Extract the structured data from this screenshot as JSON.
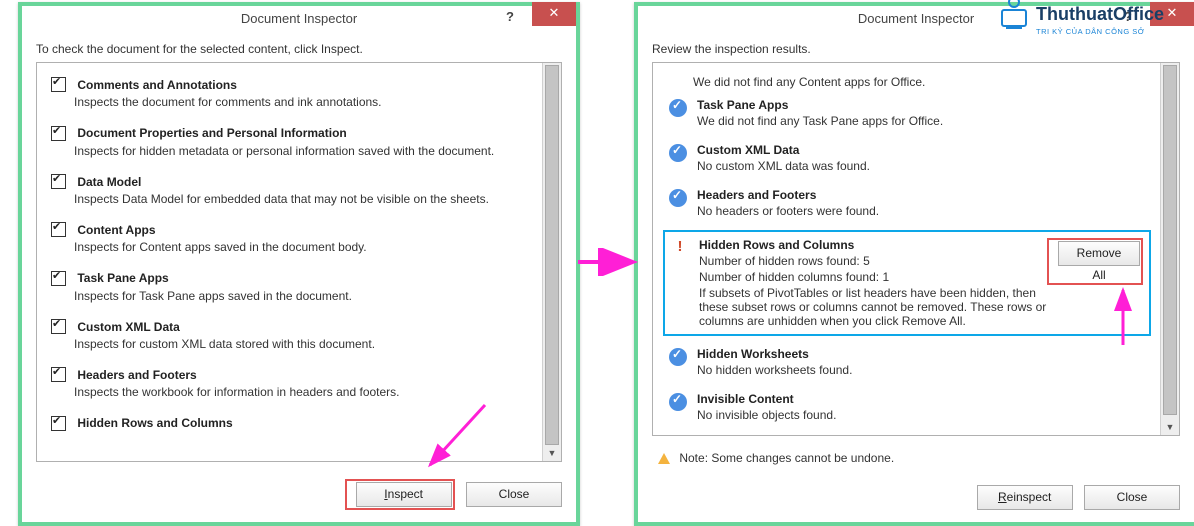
{
  "dialog1": {
    "title": "Document Inspector",
    "intro": "To check the document for the selected content, click Inspect.",
    "items": [
      {
        "label": "Comments and Annotations",
        "desc": "Inspects the document for comments and ink annotations."
      },
      {
        "label": "Document Properties and Personal Information",
        "desc": "Inspects for hidden metadata or personal information saved with the document."
      },
      {
        "label": "Data Model",
        "desc": "Inspects Data Model for embedded data that may not be visible on the sheets."
      },
      {
        "label": "Content Apps",
        "desc": "Inspects for Content apps saved in the document body."
      },
      {
        "label": "Task Pane Apps",
        "desc": "Inspects for Task Pane apps saved in the document."
      },
      {
        "label": "Custom XML Data",
        "desc": "Inspects for custom XML data stored with this document."
      },
      {
        "label": "Headers and Footers",
        "desc": "Inspects the workbook for information in headers and footers."
      }
    ],
    "cutoff": "Hidden Rows and Columns",
    "inspect": "Inspect",
    "close": "Close",
    "help": "?",
    "x": "✕"
  },
  "dialog2": {
    "title": "Document Inspector",
    "intro": "Review the inspection results.",
    "topcut": "We did not find any Content apps for Office.",
    "results": [
      {
        "ok": true,
        "title": "Task Pane Apps",
        "desc": "We did not find any Task Pane apps for Office."
      },
      {
        "ok": true,
        "title": "Custom XML Data",
        "desc": "No custom XML data was found."
      },
      {
        "ok": true,
        "title": "Headers and Footers",
        "desc": "No headers or footers were found."
      }
    ],
    "warn": {
      "title": "Hidden Rows and Columns",
      "line1": "Number of hidden rows found: 5",
      "line2": "Number of hidden columns found: 1",
      "note": "If subsets of PivotTables or list headers have been hidden, then these subset rows or columns cannot be removed. These rows or columns are unhidden when you click Remove All.",
      "action": "Remove All"
    },
    "results2": [
      {
        "ok": true,
        "title": "Hidden Worksheets",
        "desc": "No hidden worksheets found."
      },
      {
        "ok": true,
        "title": "Invisible Content",
        "desc": "No invisible objects found."
      }
    ],
    "note": "Note: Some changes cannot be undone.",
    "reinspect": "Reinspect",
    "close": "Close",
    "help": "?",
    "x": "✕"
  },
  "logo": {
    "brand": "ThuthuatOffice",
    "tag": "TRI KỶ CỦA DÂN CÔNG SỞ"
  }
}
